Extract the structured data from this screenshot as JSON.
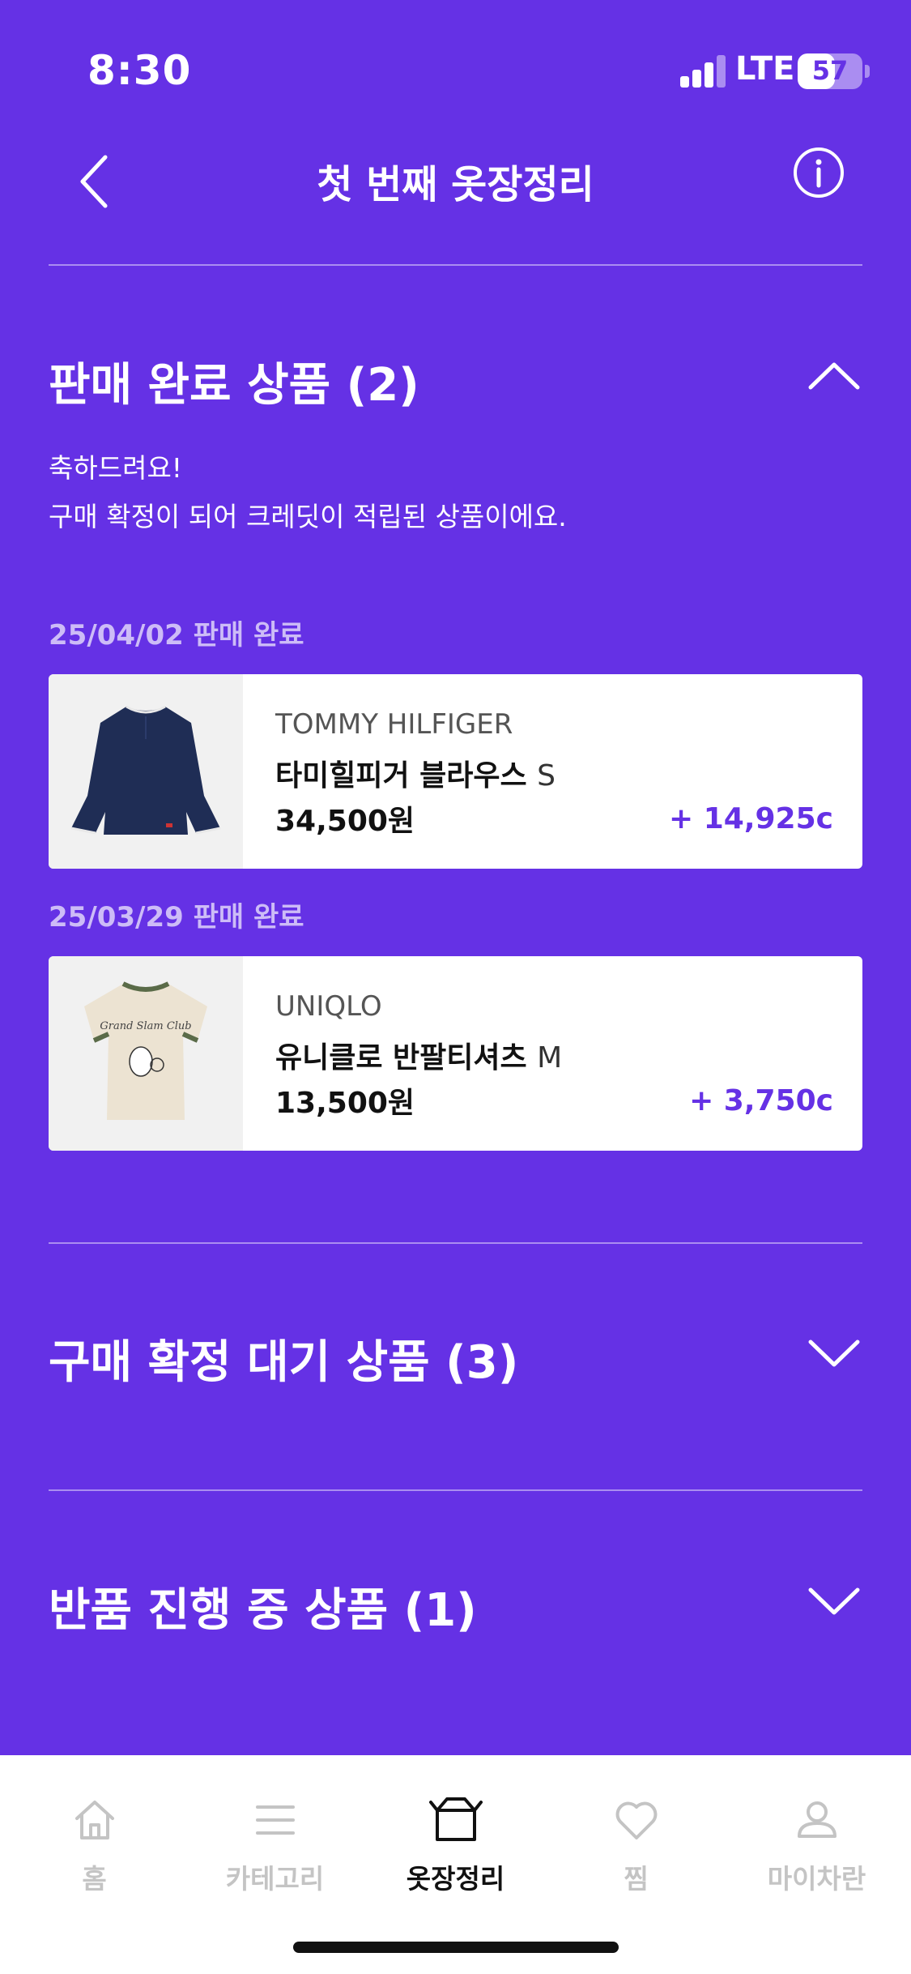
{
  "status": {
    "time": "8:30",
    "network": "LTE",
    "battery": "57",
    "battery_level": 0.57,
    "signal_bars": 3
  },
  "header": {
    "title": "첫 번째 옷장정리",
    "back_icon": "chevron-left-icon",
    "info_icon": "info-icon"
  },
  "sections": {
    "sold": {
      "title": "판매 완료 상품 (2)",
      "expanded": true,
      "message_line1": "축하드려요!",
      "message_line2": "구매 확정이 되어 크레딧이 적립된 상품이에요.",
      "items": [
        {
          "date_label": "25/04/02 판매 완료",
          "brand": "TOMMY HILFIGER",
          "name": "타미힐피거 블라우스",
          "size": "S",
          "price": "34,500원",
          "credit": "+ 14,925c"
        },
        {
          "date_label": "25/03/29 판매 완료",
          "brand": "UNIQLO",
          "name": "유니클로 반팔티셔츠",
          "size": "M",
          "price": "13,500원",
          "credit": "+ 3,750c",
          "shirt_print": "Grand Slam Club"
        }
      ]
    },
    "pending": {
      "title": "구매 확정 대기 상품 (3)",
      "expanded": false
    },
    "returning": {
      "title": "반품 진행 중 상품 (1)",
      "expanded": false
    }
  },
  "tabbar": {
    "tabs": [
      {
        "label": "홈",
        "icon": "home-icon",
        "active": false
      },
      {
        "label": "카테고리",
        "icon": "menu-icon",
        "active": false
      },
      {
        "label": "옷장정리",
        "icon": "closet-box-icon",
        "active": true
      },
      {
        "label": "찜",
        "icon": "heart-icon",
        "active": false
      },
      {
        "label": "마이차란",
        "icon": "person-icon",
        "active": false
      }
    ]
  },
  "colors": {
    "background": "#6531E5",
    "accent": "#6531E5",
    "card": "#FFFFFF",
    "tab_inactive": "#C4C4C4",
    "tab_active": "#111111"
  }
}
